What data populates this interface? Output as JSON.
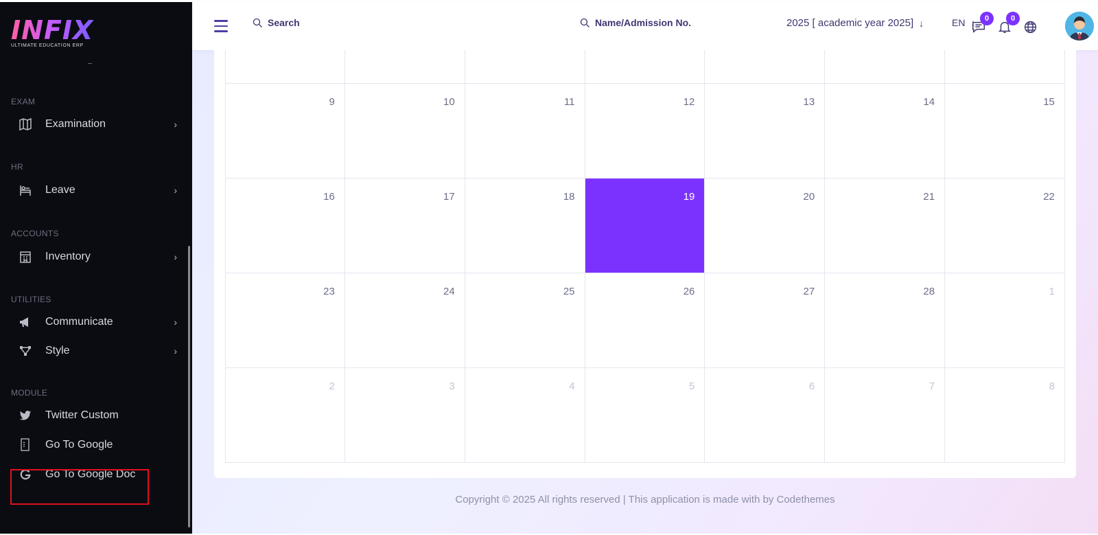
{
  "brand": {
    "logo_text": "INFIX",
    "tagline": "ULTIMATE EDUCATION ERP"
  },
  "sidebar": {
    "sections": [
      {
        "label": "EXAM",
        "items": [
          {
            "label": "Examination",
            "icon": "map-icon",
            "has_submenu": true
          }
        ]
      },
      {
        "label": "HR",
        "items": [
          {
            "label": "Leave",
            "icon": "bed-icon",
            "has_submenu": true
          }
        ]
      },
      {
        "label": "ACCOUNTS",
        "items": [
          {
            "label": "Inventory",
            "icon": "building-icon",
            "has_submenu": true
          }
        ]
      },
      {
        "label": "UTILITIES",
        "items": [
          {
            "label": "Communicate",
            "icon": "megaphone-icon",
            "has_submenu": true
          },
          {
            "label": "Style",
            "icon": "vector-icon",
            "has_submenu": true
          }
        ]
      },
      {
        "label": "MODULE",
        "items": [
          {
            "label": "Twitter Custom",
            "icon": "twitter-icon",
            "has_submenu": false
          },
          {
            "label": "Go To Google",
            "icon": "document-icon",
            "has_submenu": false
          },
          {
            "label": "Go To Google Doc",
            "icon": "google-icon",
            "has_submenu": false,
            "highlighted": true
          }
        ]
      }
    ]
  },
  "header": {
    "search_label": "Search",
    "name_search_label": "Name/Admission No.",
    "academic_year": "2025 [ academic year 2025]",
    "language": "EN",
    "messages_count": "0",
    "notifications_count": "0"
  },
  "calendar": {
    "weeks": [
      [
        "",
        "",
        "",
        "",
        "",
        "",
        ""
      ],
      [
        "9",
        "10",
        "11",
        "12",
        "13",
        "14",
        "15"
      ],
      [
        "16",
        "17",
        "18",
        "19",
        "20",
        "21",
        "22"
      ],
      [
        "23",
        "24",
        "25",
        "26",
        "27",
        "28",
        "1"
      ],
      [
        "2",
        "3",
        "4",
        "5",
        "6",
        "7",
        "8"
      ]
    ],
    "today": "19",
    "accent_color": "#7c32ff"
  },
  "footer": {
    "text": "Copyright © 2025 All rights reserved | This application is made with by Codethemes"
  }
}
